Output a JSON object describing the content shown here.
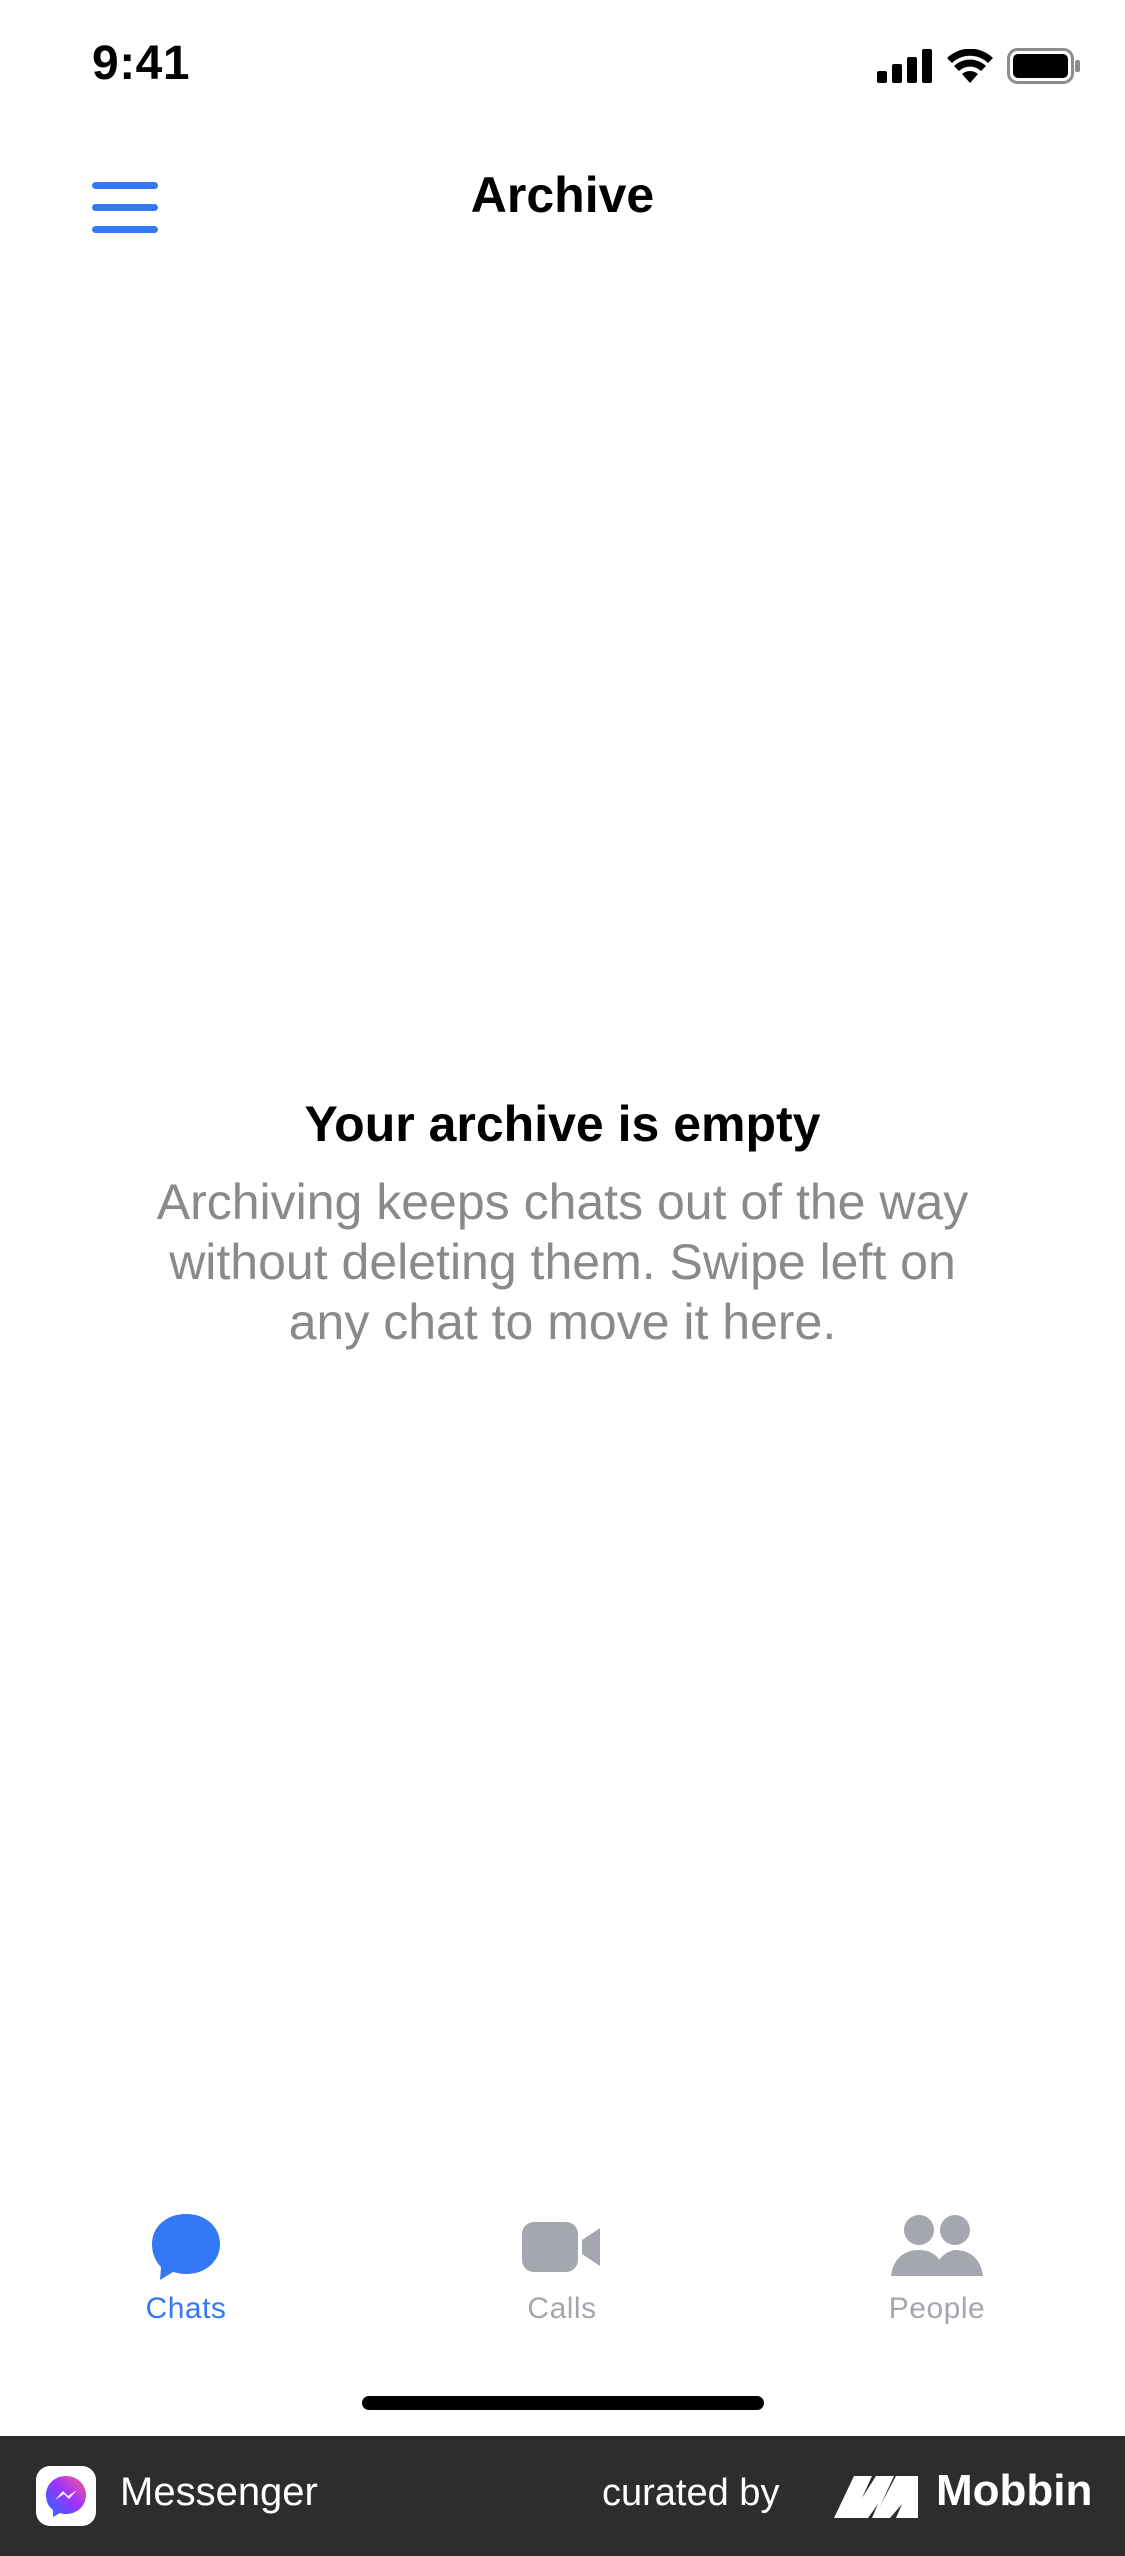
{
  "status_bar": {
    "time": "9:41",
    "icons": [
      "cellular-signal-icon",
      "wifi-icon",
      "battery-icon"
    ]
  },
  "nav": {
    "title": "Archive",
    "menu_icon": "hamburger-menu-icon"
  },
  "empty_state": {
    "title": "Your archive is empty",
    "body": "Archiving keeps chats out of the way without deleting them. Swipe left on any chat to move it here."
  },
  "tabs": [
    {
      "label": "Chats",
      "icon": "chat-bubble-icon",
      "active": true
    },
    {
      "label": "Calls",
      "icon": "video-camera-icon",
      "active": false
    },
    {
      "label": "People",
      "icon": "people-icon",
      "active": false
    }
  ],
  "footer": {
    "app_name": "Messenger",
    "curated_label": "curated by",
    "brand": "Mobbin"
  },
  "colors": {
    "accent": "#3478f6",
    "inactive": "#a4a7ad",
    "body_text": "#8a8a8e",
    "footer_bg": "#2d2d2d"
  }
}
